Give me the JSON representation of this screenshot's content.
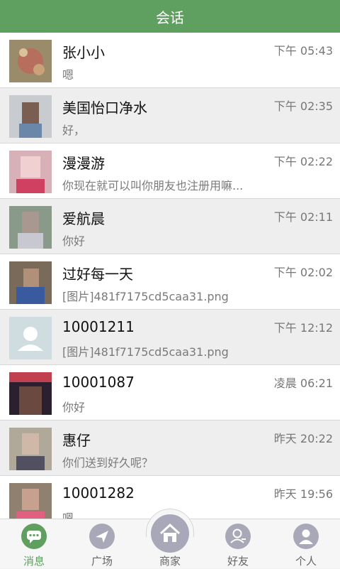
{
  "header": {
    "title": "会话"
  },
  "conversations": [
    {
      "name": "张小小",
      "message": "嗯",
      "time": "下午 05:43"
    },
    {
      "name": "美国怡口净水",
      "message": "好，",
      "time": "下午 02:35"
    },
    {
      "name": "漫漫游",
      "message": "你现在就可以叫你朋友也注册用嘛...",
      "time": "下午 02:22"
    },
    {
      "name": "爱航晨",
      "message": "你好",
      "time": "下午 02:11"
    },
    {
      "name": "过好每一天",
      "message": "[图片]481f7175cd5caa31.png",
      "time": "下午 02:02"
    },
    {
      "name": "10001211",
      "message": "[图片]481f7175cd5caa31.png",
      "time": "下午 12:12"
    },
    {
      "name": "10001087",
      "message": "你好",
      "time": "凌晨 06:21"
    },
    {
      "name": "惠仔",
      "message": "你们送到好久呢？",
      "time": "昨天 20:22"
    },
    {
      "name": "10001282",
      "message": "嗯",
      "time": "昨天 19:56"
    }
  ],
  "tabs": [
    {
      "label": "消息",
      "icon": "message-icon"
    },
    {
      "label": "广场",
      "icon": "compass-icon"
    },
    {
      "label": "商家",
      "icon": "home-icon"
    },
    {
      "label": "好友",
      "icon": "friends-icon"
    },
    {
      "label": "个人",
      "icon": "person-icon"
    }
  ],
  "colors": {
    "accent": "#5f9f5f",
    "inactive_icon": "#a8a8b8"
  }
}
